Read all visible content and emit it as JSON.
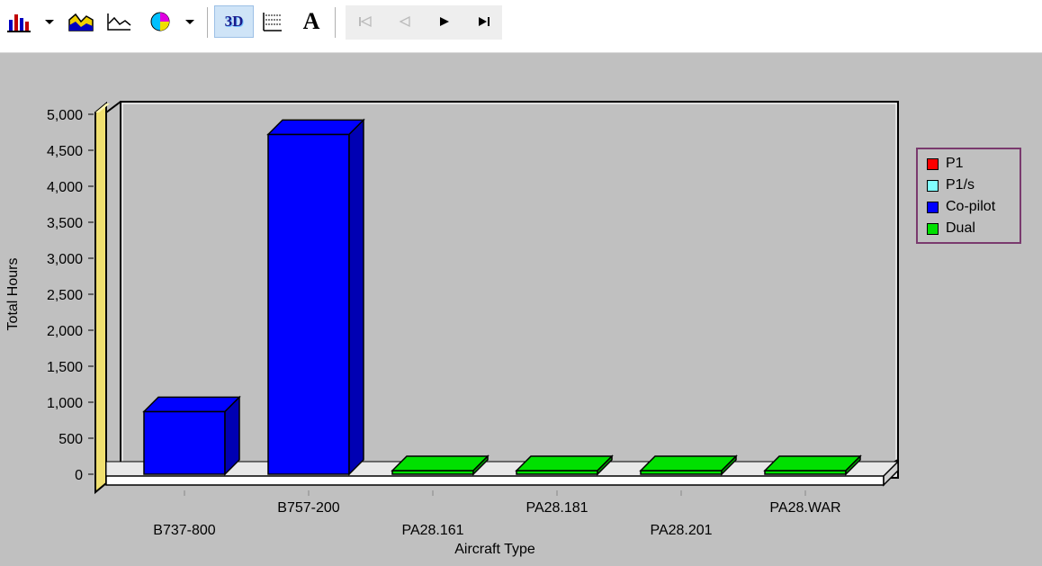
{
  "toolbar": {
    "buttons": [
      {
        "name": "bar-chart-icon",
        "label": ""
      },
      {
        "name": "chart-type-dropdown-icon",
        "label": ""
      },
      {
        "name": "area-chart-icon",
        "label": ""
      },
      {
        "name": "line-chart-icon",
        "label": ""
      },
      {
        "name": "pie-chart-icon",
        "label": ""
      },
      {
        "name": "pie-dropdown-icon",
        "label": ""
      },
      {
        "name": "3d-toggle-icon",
        "label": "3D"
      },
      {
        "name": "gridlines-icon",
        "label": ""
      },
      {
        "name": "font-icon",
        "label": "A"
      },
      {
        "name": "first-page-icon",
        "label": ""
      },
      {
        "name": "previous-page-icon",
        "label": ""
      },
      {
        "name": "next-page-icon",
        "label": ""
      },
      {
        "name": "last-page-icon",
        "label": ""
      }
    ]
  },
  "colors": {
    "background": "#c0c0c0",
    "wall_left": "#f0e070",
    "floor": "#ffffff",
    "legend_border": "#7a3a6e"
  },
  "chart_data": {
    "type": "bar",
    "categories": [
      "B737-800",
      "B757-200",
      "PA28.161",
      "PA28.181",
      "PA28.201",
      "PA28.WAR"
    ],
    "series": [
      {
        "name": "P1",
        "color": "#ff0000",
        "values": [
          0,
          0,
          0,
          0,
          0,
          0
        ]
      },
      {
        "name": "P1/s",
        "color": "#80ffff",
        "values": [
          0,
          0,
          0,
          0,
          0,
          0
        ]
      },
      {
        "name": "Co-pilot",
        "color": "#0000ff",
        "values": [
          870,
          4720,
          0,
          0,
          0,
          0
        ]
      },
      {
        "name": "Dual",
        "color": "#00e000",
        "values": [
          0,
          0,
          40,
          15,
          30,
          10
        ]
      }
    ],
    "xlabel": "Aircraft Type",
    "ylabel": "Total Hours",
    "ylim": [
      0,
      5000
    ],
    "yticks": [
      "0",
      "500",
      "1,000",
      "1,500",
      "2,000",
      "2,500",
      "3,000",
      "3,500",
      "4,000",
      "4,500",
      "5,000"
    ],
    "legend_position": "top-right",
    "three_d": true
  }
}
